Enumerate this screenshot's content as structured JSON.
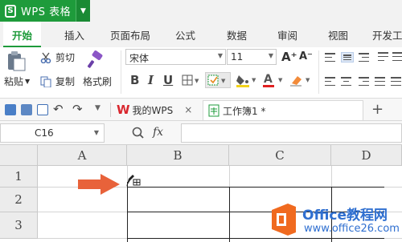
{
  "app": {
    "title": "WPS 表格",
    "logo_letter": "S"
  },
  "menu": {
    "tabs": [
      "开始",
      "插入",
      "页面布局",
      "公式",
      "数据",
      "审阅",
      "视图",
      "开发工"
    ],
    "active": "开始"
  },
  "ribbon": {
    "paste_label": "粘贴",
    "cut_label": "剪切",
    "copy_label": "复制",
    "format_painter_label": "格式刷",
    "font_name": "宋体",
    "font_size": "11",
    "bold": "B",
    "italic": "I",
    "underline": "U",
    "grow_font": "A⁺",
    "shrink_font": "A⁻",
    "font_color_letter": "A"
  },
  "quickbar": {
    "tab1_label": "我的WPS",
    "tab2_label": "工作簿1 *",
    "close_glyph": "×",
    "plus_glyph": "+"
  },
  "formula_bar": {
    "cell_ref": "C16",
    "fx_label": "fx"
  },
  "grid": {
    "columns": [
      "A",
      "B",
      "C",
      "D"
    ],
    "rows": [
      "1",
      "2",
      "3"
    ]
  },
  "watermark": {
    "title": "Office教程网",
    "url": "www.office26.com"
  },
  "colors": {
    "brand_green": "#1e9b3b",
    "arrow": "#e8623a",
    "watermark_orange": "#f06a1f",
    "watermark_blue": "#2f6fd0"
  }
}
